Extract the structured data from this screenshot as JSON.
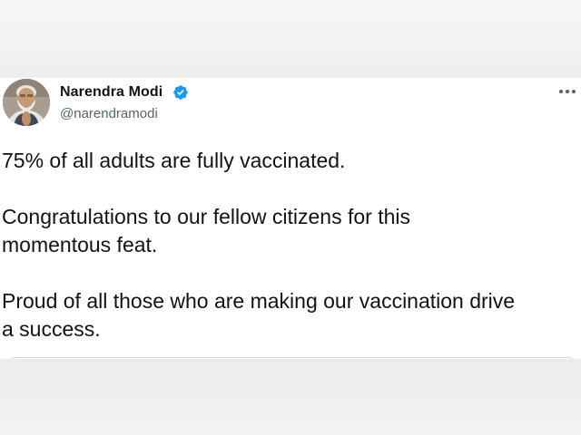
{
  "tweet": {
    "author_name": "Narendra Modi",
    "author_handle": "@narendramodi",
    "verified": true,
    "more_icon": "more-horizontal-icon",
    "avatar_icon": "profile-avatar",
    "paragraphs": [
      [
        "75% of all adults are fully vaccinated."
      ],
      [
        "Congratulations to our fellow citizens for this",
        "momentous feat."
      ],
      [
        "Proud of all those who are making our vaccination drive",
        "a success."
      ]
    ]
  },
  "colors": {
    "text": "#0f1419",
    "handle": "#536471",
    "verified_badge": "#1d9bf0",
    "card_background": "#ffffff",
    "page_background": "#f2f2f2"
  }
}
